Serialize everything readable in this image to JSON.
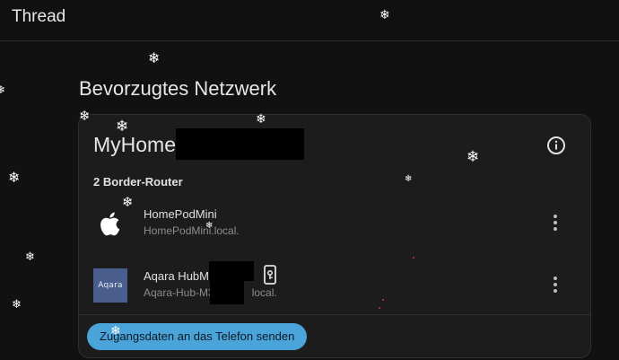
{
  "app": {
    "title": "Thread"
  },
  "section": {
    "title": "Bevorzugtes Netzwerk"
  },
  "network": {
    "name": "MyHome",
    "router_count_label": "2 Border-Router",
    "routers": [
      {
        "name": "HomePodMini",
        "host": "HomePodMini.local.",
        "icon": "apple-logo-icon"
      },
      {
        "name": "Aqara HubM3",
        "host": "Aqara-Hub-M3-",
        "host_suffix": "local.",
        "icon": "aqara-logo",
        "logo_text": "Aqara"
      }
    ]
  },
  "actions": {
    "send_credentials_label": "Zugangsdaten an das Telefon senden"
  },
  "colors": {
    "background": "#111111",
    "card": "#1c1c1c",
    "accent": "#4aa3d9",
    "aqara_brand": "#4a5e8e"
  }
}
